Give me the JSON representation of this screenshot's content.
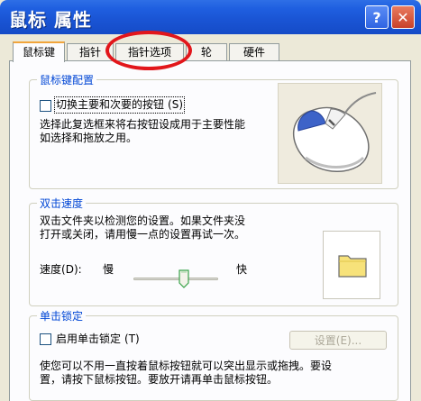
{
  "window": {
    "title": "鼠标 属性",
    "help_label": "?",
    "close_label": "✕"
  },
  "tabs": [
    {
      "label": "鼠标键",
      "active": true
    },
    {
      "label": "指针",
      "active": false
    },
    {
      "label": "指针选项",
      "active": false
    },
    {
      "label": "轮",
      "active": false
    },
    {
      "label": "硬件",
      "active": false
    }
  ],
  "button_config": {
    "title": "鼠标键配置",
    "switch_label": "切换主要和次要的按钮",
    "switch_hotkey": "(S)",
    "switch_checked": false,
    "description_line1": "选择此复选框来将右按钮设成用于主要性能",
    "description_line2": "如选择和拖放之用。",
    "image_icon": "mouse-icon"
  },
  "double_click": {
    "title": "双击速度",
    "description_line1": "双击文件夹以检测您的设置。如果文件夹没",
    "description_line2": "打开或关闭，请用慢一点的设置再试一次。",
    "speed_label": "速度",
    "speed_hotkey": "(D)",
    "slow_label": "慢",
    "fast_label": "快",
    "speed_level": 0.5,
    "test_icon": "folder-icon"
  },
  "click_lock": {
    "title": "单击锁定",
    "checkbox_label": "启用单击锁定",
    "checkbox_hotkey": "(T)",
    "checked": false,
    "settings_button": "设置(E)...",
    "description_line1": "使您可以不用一直按着鼠标按钮就可以突出显示或拖拽。要设",
    "description_line2": "置，请按下鼠标按钮。要放开请再单击鼠标按钮。"
  },
  "colors": {
    "titlebar": "#1A55D5",
    "highlight_ellipse": "#E2161B",
    "group_title": "#0046D5"
  }
}
